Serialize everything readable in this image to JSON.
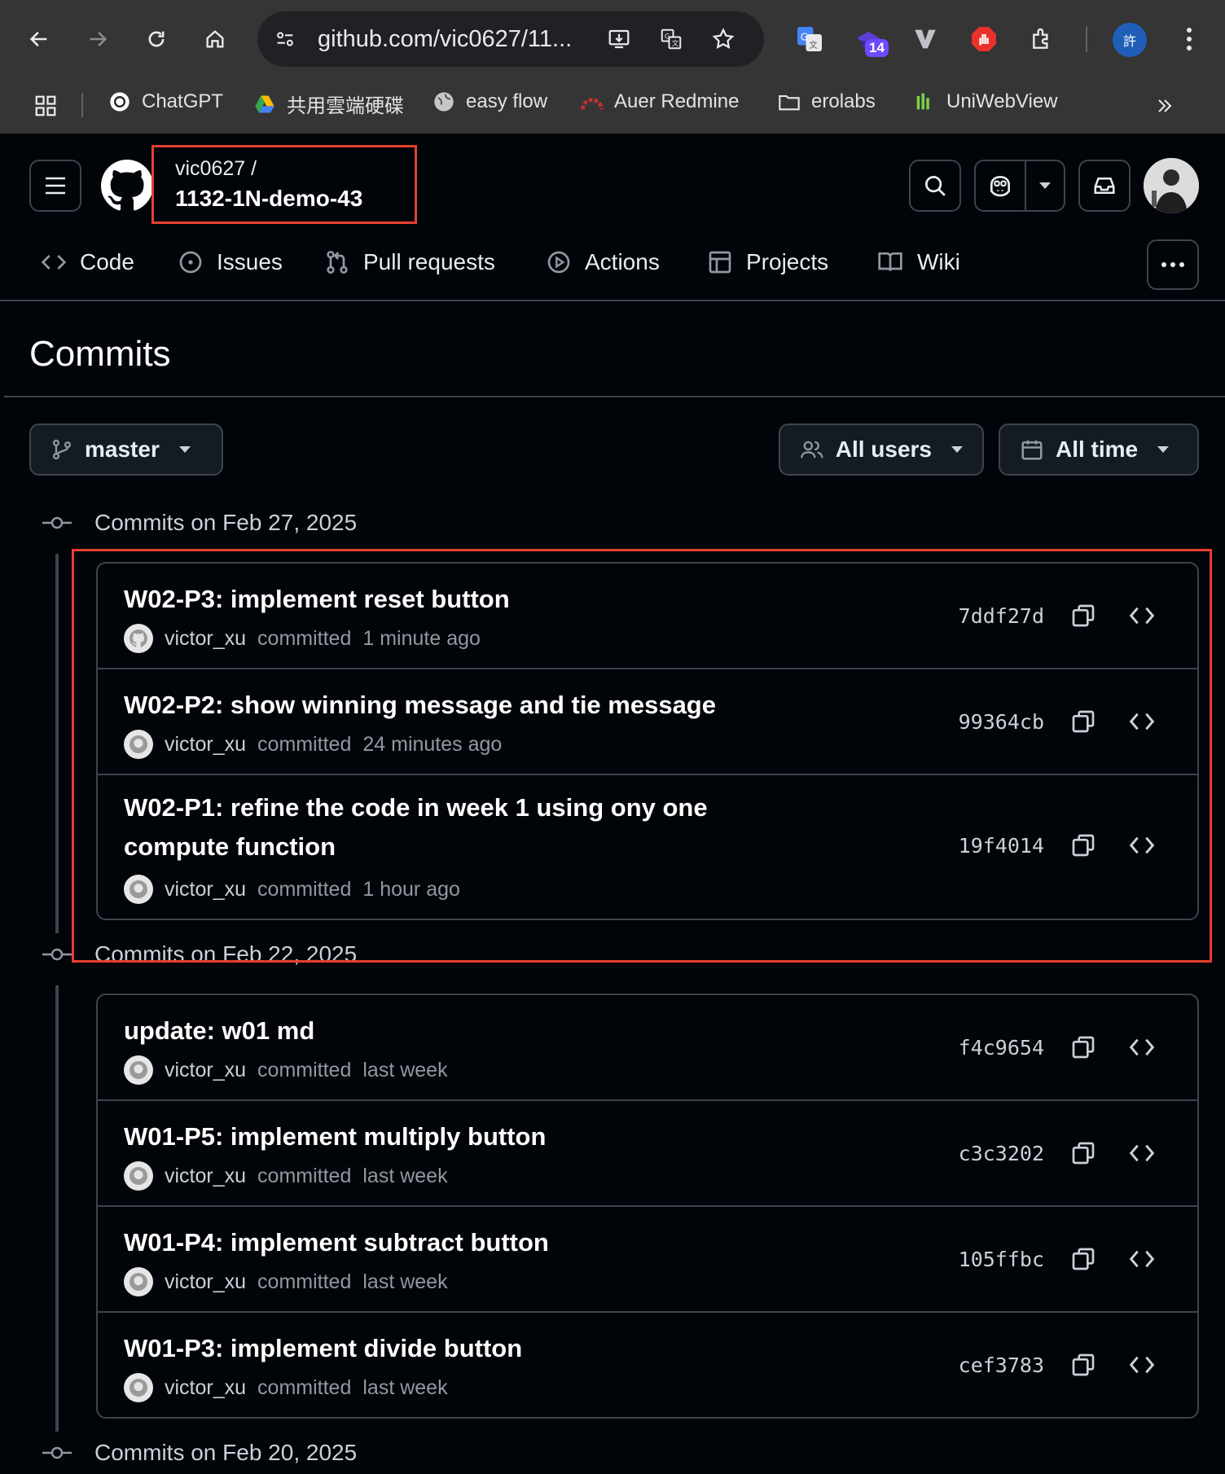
{
  "browser": {
    "url": "github.com/vic0627/11...",
    "extension_badge": "14",
    "profile_initial": "許",
    "bookmarks": [
      {
        "label": "ChatGPT",
        "icon": "chatgpt-icon"
      },
      {
        "label": "共用雲端硬碟",
        "icon": "google-drive-icon"
      },
      {
        "label": "easy flow",
        "icon": "globe-icon"
      },
      {
        "label": "Auer Redmine",
        "icon": "redmine-icon"
      },
      {
        "label": "erolabs",
        "icon": "folder-icon"
      },
      {
        "label": "UniWebView",
        "icon": "uniwebview-icon"
      }
    ]
  },
  "repo": {
    "owner": "vic0627 /",
    "name": "1132-1N-demo-43"
  },
  "nav": {
    "tabs": [
      {
        "label": "Code",
        "icon": "code-icon"
      },
      {
        "label": "Issues",
        "icon": "issue-icon"
      },
      {
        "label": "Pull requests",
        "icon": "pull-request-icon"
      },
      {
        "label": "Actions",
        "icon": "play-icon"
      },
      {
        "label": "Projects",
        "icon": "table-icon"
      },
      {
        "label": "Wiki",
        "icon": "book-icon"
      }
    ]
  },
  "page": {
    "title": "Commits"
  },
  "filters": {
    "branch": "master",
    "users": "All users",
    "time": "All time"
  },
  "groups": [
    {
      "heading": "Commits on Feb 27, 2025",
      "commits": [
        {
          "message": "W02-P3: implement reset button",
          "author": "victor_xu",
          "verb": "committed",
          "time": "1 minute ago",
          "sha": "7ddf27d"
        },
        {
          "message": "W02-P2: show winning message and tie message",
          "author": "victor_xu",
          "verb": "committed",
          "time": "24 minutes ago",
          "sha": "99364cb"
        },
        {
          "message": "W02-P1: refine the code in week 1 using ony one compute function",
          "author": "victor_xu",
          "verb": "committed",
          "time": "1 hour ago",
          "sha": "19f4014"
        }
      ]
    },
    {
      "heading": "Commits on Feb 22, 2025",
      "commits": [
        {
          "message": "update: w01 md",
          "author": "victor_xu",
          "verb": "committed",
          "time": "last week",
          "sha": "f4c9654"
        },
        {
          "message": "W01-P5: implement multiply button",
          "author": "victor_xu",
          "verb": "committed",
          "time": "last week",
          "sha": "c3c3202"
        },
        {
          "message": "W01-P4: implement subtract button",
          "author": "victor_xu",
          "verb": "committed",
          "time": "last week",
          "sha": "105ffbc"
        },
        {
          "message": "W01-P3: implement divide button",
          "author": "victor_xu",
          "verb": "committed",
          "time": "last week",
          "sha": "cef3783"
        }
      ]
    },
    {
      "heading": "Commits on Feb 20, 2025",
      "commits": []
    }
  ],
  "colors": {
    "background": "#010409",
    "border": "#3d444d",
    "highlight": "#e5402f",
    "browser_chrome": "#353535"
  }
}
